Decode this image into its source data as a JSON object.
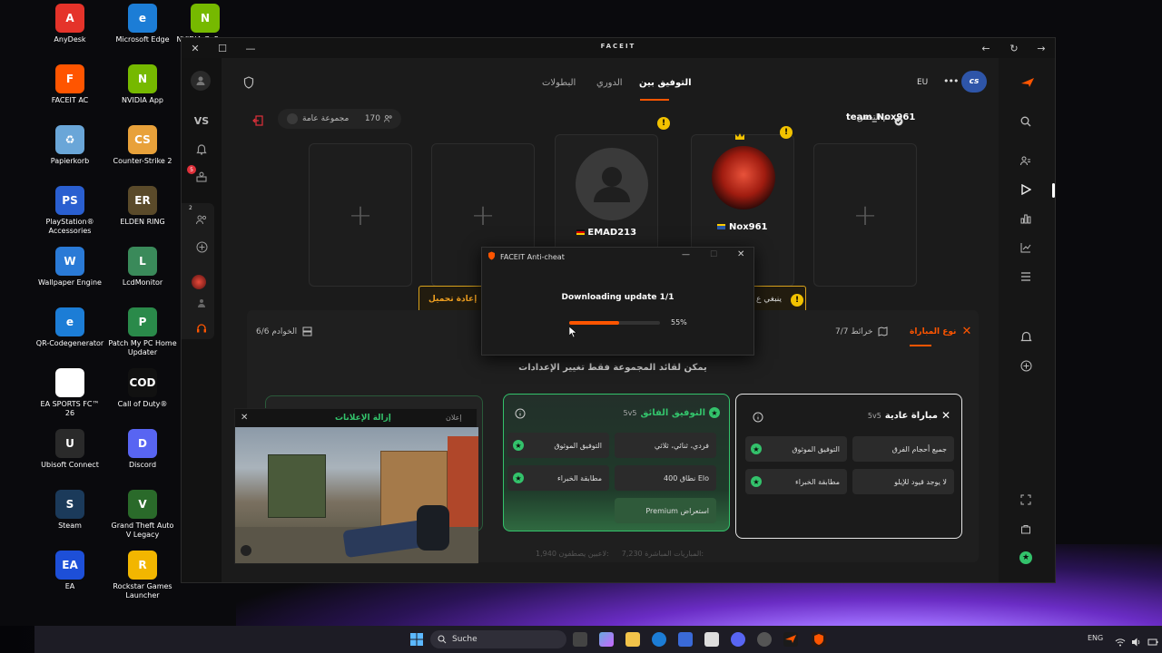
{
  "desktop": {
    "icons": [
      {
        "label": "AnyDesk",
        "badge": "A",
        "color": "#e5332a"
      },
      {
        "label": "Microsoft Edge",
        "badge": "e",
        "color": "#1c7dd6"
      },
      {
        "label": "NVIDIA GeForce NOW",
        "badge": "N",
        "color": "#76b900"
      },
      {
        "label": "FACEIT AC",
        "badge": "F",
        "color": "#ff5500"
      },
      {
        "label": "NVIDIA App",
        "badge": "N",
        "color": "#76b900"
      },
      {
        "label": "Papierkorb",
        "badge": "♻",
        "color": "#6aa6d8"
      },
      {
        "label": "Counter-Strike 2",
        "badge": "CS",
        "color": "#e8a13a"
      },
      {
        "label": "PlayStation® Accessories",
        "badge": "PS",
        "color": "#2a5fd0"
      },
      {
        "label": "ELDEN RING",
        "badge": "ER",
        "color": "#5a4a2a"
      },
      {
        "label": "Wallpaper Engine",
        "badge": "W",
        "color": "#2a7ad6"
      },
      {
        "label": "LcdMonitor",
        "badge": "L",
        "color": "#3a8a5a"
      },
      {
        "label": "QR-Codegenerator",
        "badge": "e",
        "color": "#1c7dd6"
      },
      {
        "label": "Patch My PC Home Updater",
        "badge": "P",
        "color": "#2a8a4a"
      },
      {
        "label": "EA SPORTS FC™ 26",
        "badge": "",
        "color": "#ffffff"
      },
      {
        "label": "Call of Duty®",
        "badge": "COD",
        "color": "#111111"
      },
      {
        "label": "Ubisoft Connect",
        "badge": "U",
        "color": "#2a2a2a"
      },
      {
        "label": "Discord",
        "badge": "D",
        "color": "#5865f2"
      },
      {
        "label": "Steam",
        "badge": "S",
        "color": "#1b3a5a"
      },
      {
        "label": "Grand Theft Auto V Legacy",
        "badge": "V",
        "color": "#2a6a2a"
      },
      {
        "label": "EA",
        "badge": "EA",
        "color": "#1d4fd8"
      },
      {
        "label": "Rockstar Games Launcher",
        "badge": "R",
        "color": "#f2b600"
      }
    ]
  },
  "window": {
    "title": "FACEIT",
    "controls": {
      "close": "✕",
      "restore": "☐",
      "minimize": "—",
      "back": "←",
      "reload": "↻",
      "forward": "→"
    }
  },
  "left_rail": {
    "vs_label": "VS",
    "notif_count": "5",
    "friends_count": "2"
  },
  "nav": {
    "tabs": [
      "التوفيق بين",
      "الدوري",
      "البطولات"
    ],
    "region": "EU",
    "more": "•••",
    "cs_badge": "cs"
  },
  "party": {
    "player_name": "team_Nox961",
    "verified_label": "تم التحقق",
    "group_count": "170",
    "group_label": "مجموعة عامة"
  },
  "slots": {
    "plus": "+",
    "players": [
      {
        "name": "EMAD213",
        "flag": "de"
      },
      {
        "name": "Nox961",
        "flag": "se"
      }
    ]
  },
  "notices": {
    "reload_label": "إعادة تحميل",
    "leader_notice": "ينبغي ع"
  },
  "settings": {
    "servers_label": "الخوادم 6/6",
    "maps_label": "خرائط 7/7",
    "match_type_label": "نوع المباراة",
    "leader_only": "يمكن لقائد المجموعة فقط تغيير الإعدادات",
    "stats": {
      "live_matches_label": "المباريات المباشرة:",
      "live_matches": "7,230",
      "queued_label": "لاعبين يصطفون:",
      "queued": "1,940"
    },
    "cards": [
      {
        "title": "مباراة عادية",
        "format": "5v5",
        "features": [
          "جميع أحجام الفرق",
          "التوفيق الموثوق",
          "لا يوجد قيود للإيلو",
          "مطابقة الخبراء"
        ]
      },
      {
        "title": "التوفيق الفائق",
        "format": "5v5",
        "features": [
          "فردي، ثنائي، ثلاثي",
          "التوفيق الموثوق",
          "نطاق 400 Elo",
          "مطابقة الخبراء",
          "Premium استعراض"
        ]
      }
    ]
  },
  "anticheat": {
    "title": "FACEIT Anti-cheat",
    "message": "Downloading update 1/1",
    "progress": 0.55,
    "progress_label": "55%"
  },
  "ad": {
    "title": "إزالة الإعلانات",
    "label": "إعلان",
    "close": "✕"
  },
  "taskbar": {
    "search_placeholder": "Suche",
    "lang": "ENG"
  }
}
